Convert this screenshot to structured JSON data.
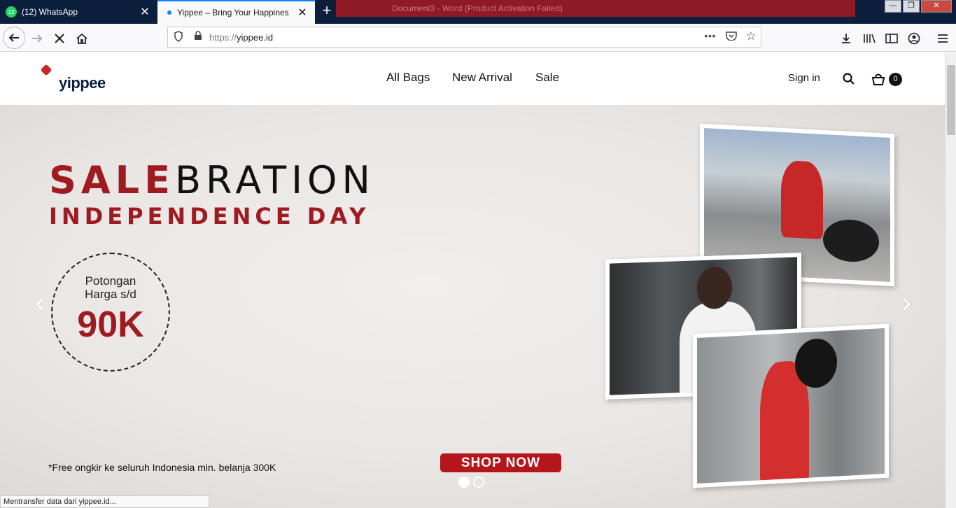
{
  "browser": {
    "tabs": [
      {
        "title": "(12) WhatsApp",
        "badge": "12"
      },
      {
        "title": "Yippee – Bring Your Happines"
      }
    ],
    "background_window_title": "Document3 - Word (Product Activation Failed)",
    "url_scheme": "https://",
    "url_host": "yippee.id",
    "status_text": "Mentransfer data dari yippee.id..."
  },
  "site": {
    "logo_text": "yippee",
    "nav": [
      "All Bags",
      "New Arrival",
      "Sale"
    ],
    "sign_in": "Sign in",
    "cart_count": "0"
  },
  "hero": {
    "title_highlight": "SALE",
    "title_rest": "BRATION",
    "subtitle": "INDEPENDENCE DAY",
    "discount_line1": "Potongan",
    "discount_line2": "Harga s/d",
    "discount_amount": "90K",
    "shipping_note": "*Free ongkir ke seluruh Indonesia min. belanja 300K",
    "cta": "SHOP NOW",
    "slide_count": 2,
    "active_slide": 1
  },
  "colors": {
    "brand_red": "#9e1b22",
    "brand_navy": "#0c1f3d",
    "cta_red": "#b4161c"
  }
}
